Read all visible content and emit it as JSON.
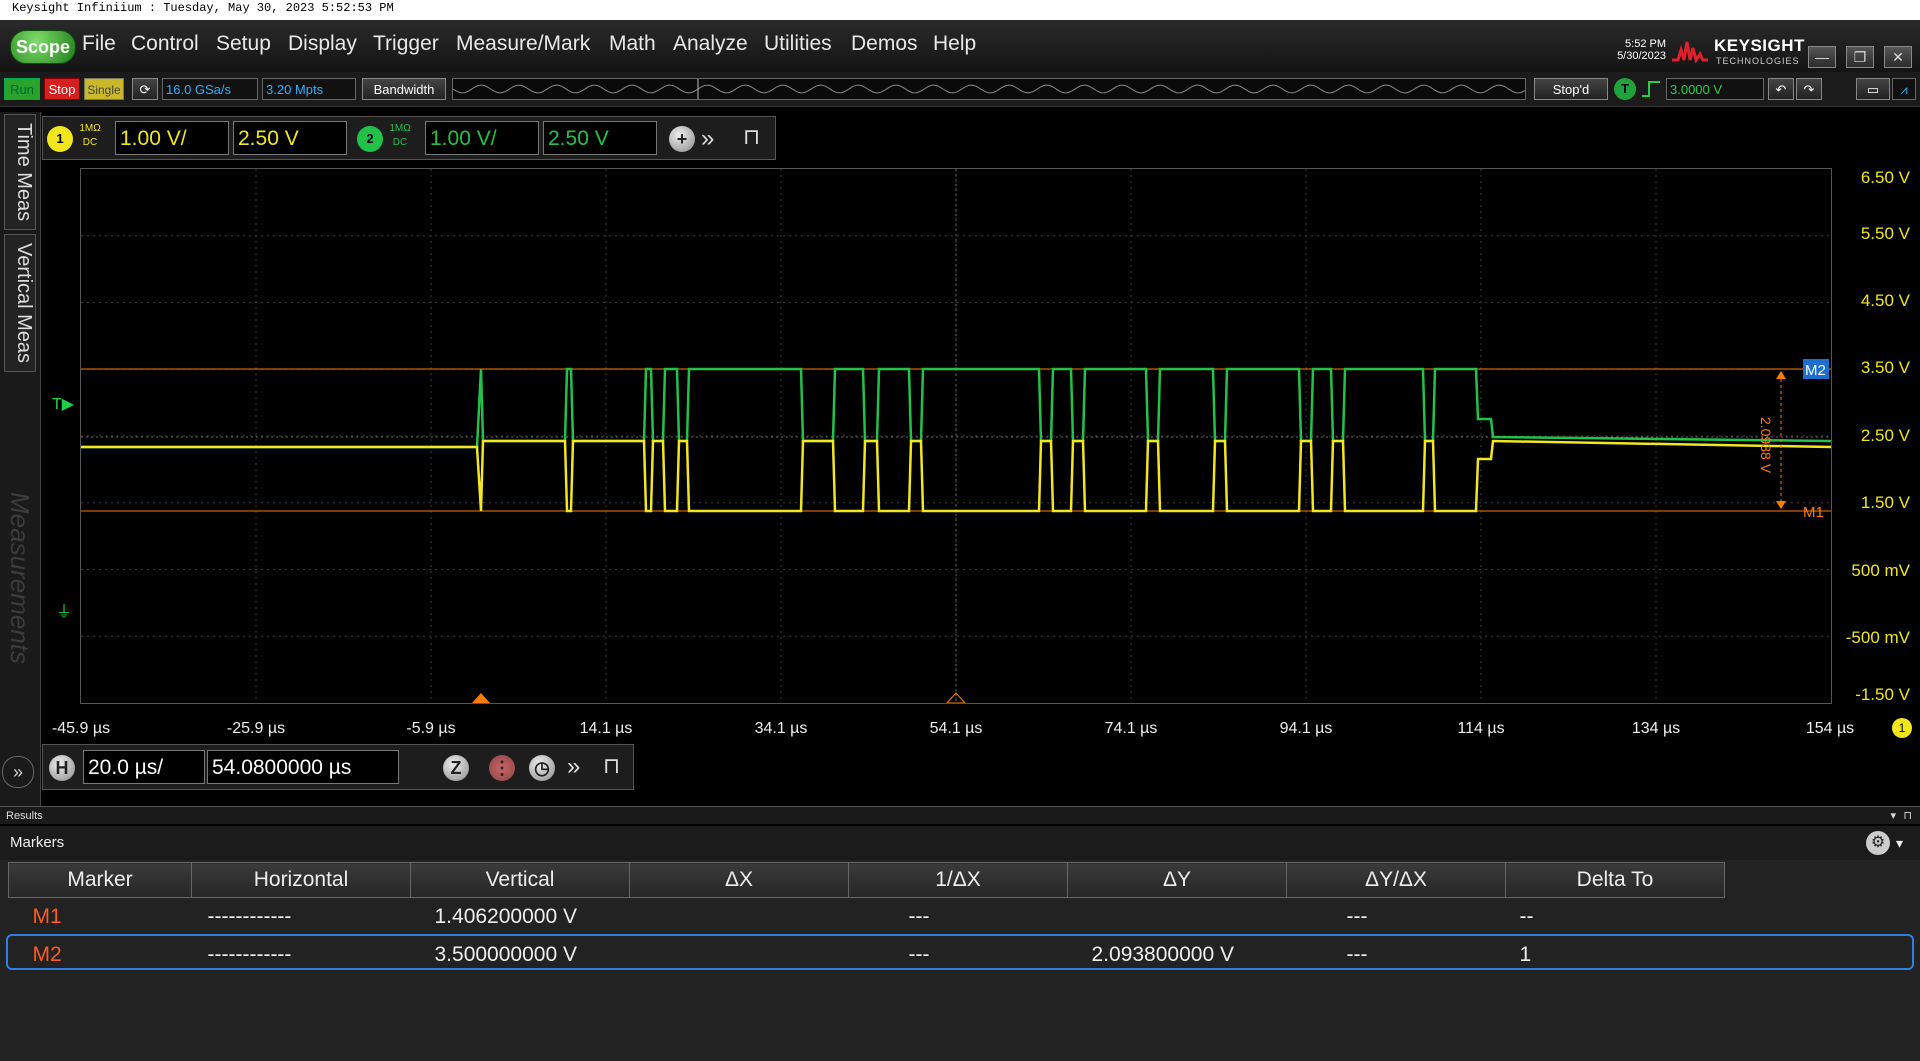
{
  "caption": "Keysight Infiniium : Tuesday, May 30, 2023 5:52:53 PM",
  "menubar": {
    "scope_label": "Scope",
    "items": [
      "File",
      "Control",
      "Setup",
      "Display",
      "Trigger",
      "Measure/Mark",
      "Math",
      "Analyze",
      "Utilities",
      "Demos",
      "Help"
    ],
    "time": "5:52 PM",
    "date": "5/30/2023",
    "logo": "KEYSIGHT",
    "logo_sub": "TECHNOLOGIES"
  },
  "toolbar": {
    "run": "Run",
    "stop": "Stop",
    "single": "Single",
    "sample_rate": "16.0 GSa/s",
    "memory": "3.20 Mpts",
    "bandwidth": "Bandwidth",
    "status": "Stop'd",
    "trigger_icon": "T",
    "trigger_level": "3.0000 V"
  },
  "side_tabs": {
    "time_meas": "Time Meas",
    "vertical_meas": "Vertical Meas",
    "measurements": "Measurements"
  },
  "channels": [
    {
      "num": "1",
      "impedance": "1MΩ",
      "coupling": "DC",
      "scale": "1.00 V/",
      "offset": "2.50 V",
      "color": "#f2e61f"
    },
    {
      "num": "2",
      "impedance": "1MΩ",
      "coupling": "DC",
      "scale": "1.00 V/",
      "offset": "2.50 V",
      "color": "#22c24a"
    }
  ],
  "y_axis": [
    "6.50 V",
    "5.50 V",
    "4.50 V",
    "3.50 V",
    "2.50 V",
    "1.50 V",
    "500 mV",
    "-500 mV",
    "-1.50 V"
  ],
  "x_axis": [
    "-45.9 µs",
    "-25.9 µs",
    "-5.9 µs",
    "14.1 µs",
    "34.1 µs",
    "54.1 µs",
    "74.1 µs",
    "94.1 µs",
    "114 µs",
    "134 µs",
    "154 µs"
  ],
  "plot": {
    "marker_m1": "M1",
    "marker_m2": "M2",
    "delta_label": "2.0938 V",
    "trigger_marker": "T",
    "ch1_badge": "1",
    "marker_color": "#ff7a00"
  },
  "horizontal": {
    "label": "H",
    "scale": "20.0 µs/",
    "position": "54.0800000 µs"
  },
  "results": {
    "title": "Results",
    "section": "Markers"
  },
  "markers_table": {
    "headers": [
      "Marker",
      "Horizontal",
      "Vertical",
      "ΔX",
      "1/ΔX",
      "ΔY",
      "ΔY/ΔX",
      "Delta To"
    ],
    "rows": [
      {
        "marker": "M1",
        "horizontal": "------------",
        "vertical": "1.406200000 V",
        "dx": "",
        "inv_dx": "---",
        "dy": "",
        "dy_dx": "---",
        "delta_to": "--"
      },
      {
        "marker": "M2",
        "horizontal": "------------",
        "vertical": "3.500000000 V",
        "dx": "",
        "inv_dx": "---",
        "dy": "2.093800000 V",
        "dy_dx": "---",
        "delta_to": "1"
      }
    ]
  }
}
